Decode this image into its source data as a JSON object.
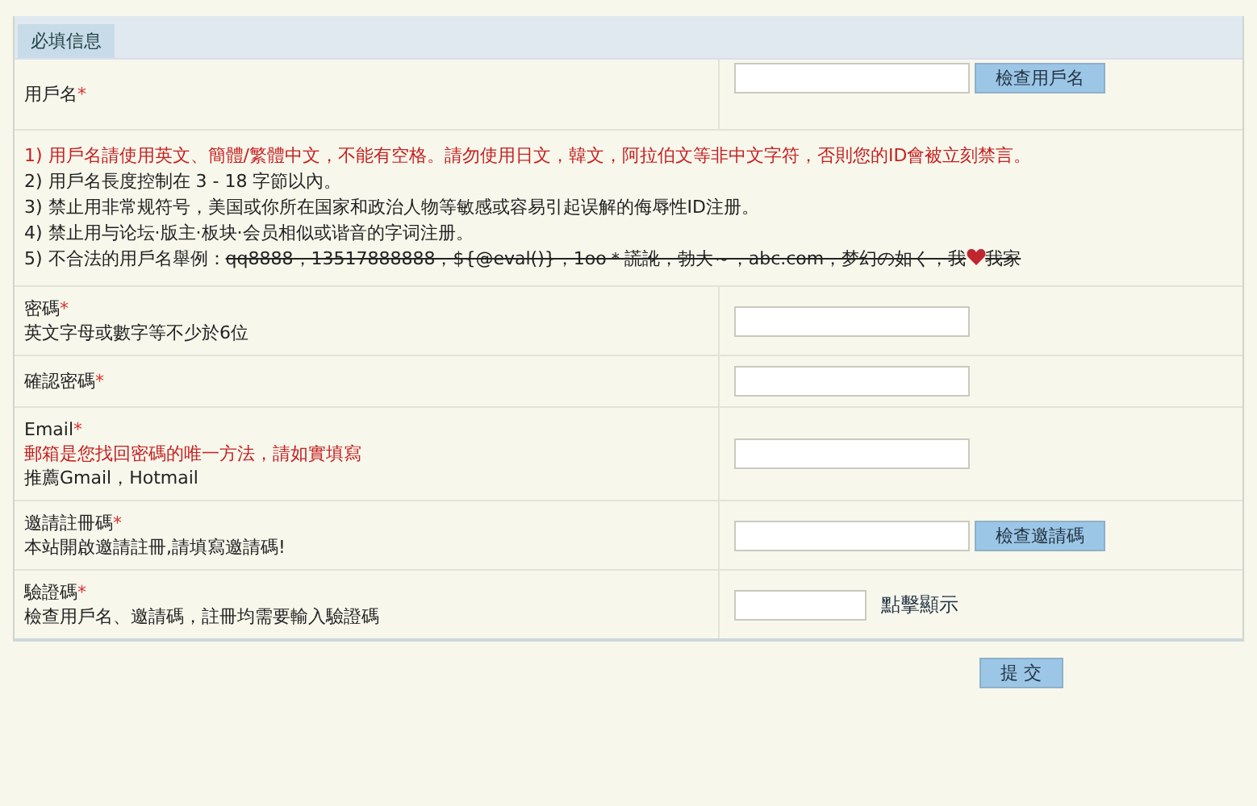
{
  "section_tab": "必填信息",
  "username": {
    "label": "用戶名",
    "mark": "*",
    "button": "檢查用戶名"
  },
  "rules": [
    {
      "number": "1)",
      "text": "用戶名請使用英文、簡體/繁體中文，不能有空格。請勿使用日文，韓文，阿拉伯文等非中文字符，否則您的ID會被立刻禁言。",
      "kind": "warning"
    },
    {
      "number": "2)",
      "text": "用戶名長度控制在 3 - 18 字節以內。",
      "kind": "normal"
    },
    {
      "number": "3)",
      "text": "禁止用非常规符号，美国或你所在国家和政治人物等敏感或容易引起误解的侮辱性ID注册。",
      "kind": "normal"
    },
    {
      "number": "4)",
      "text": "禁止用与论坛·版主·板块·会员相似或谐音的字词注册。",
      "kind": "normal"
    },
    {
      "number": "5)",
      "text": "不合法的用戶名舉例：",
      "kind": "examples",
      "struck": "qq8888，13517888888，${@eval()}，1oo＊謊訛，勃大～，abc.com，梦幻の如く，我",
      "after": "我家"
    }
  ],
  "fields": [
    {
      "label": "密碼",
      "mark": "*",
      "notes": [
        {
          "text": "英文字母或數字等不少於6位",
          "kind": "normal"
        }
      ],
      "kind": "plain"
    },
    {
      "label": "確認密碼",
      "mark": "*",
      "kind": "plain"
    },
    {
      "label": "Email",
      "mark": "*",
      "notes": [
        {
          "text": "郵箱是您找回密碼的唯一方法，請如實填寫",
          "kind": "warning"
        },
        {
          "text": "推薦Gmail，Hotmail",
          "kind": "normal"
        }
      ],
      "kind": "plain"
    },
    {
      "label": "邀請註冊碼",
      "mark": "*",
      "notes": [
        {
          "text": "本站開啟邀請註冊,請填寫邀請碼!",
          "kind": "normal"
        }
      ],
      "kind": "button",
      "button": "檢查邀請碼"
    },
    {
      "label": "驗證碼",
      "mark": "*",
      "notes": [
        {
          "text": "檢查用戶名、邀請碼，註冊均需要輸入驗證碼",
          "kind": "normal"
        }
      ],
      "kind": "captcha",
      "link": "點擊顯示"
    }
  ],
  "submit": "提 交"
}
